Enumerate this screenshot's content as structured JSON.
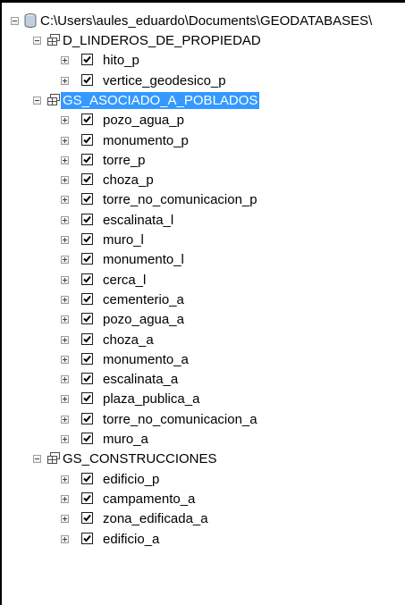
{
  "root": {
    "label": "C:\\Users\\aules_eduardo\\Documents\\GEODATABASES\\",
    "icon": "database-icon"
  },
  "datasets": [
    {
      "label": "D_LINDEROS_DE_PROPIEDAD",
      "icon": "feature-dataset-icon",
      "selected": false,
      "layers": [
        "hito_p",
        "vertice_geodesico_p"
      ]
    },
    {
      "label": "GS_ASOCIADO_A_POBLADOS",
      "icon": "feature-dataset-icon",
      "selected": true,
      "layers": [
        "pozo_agua_p",
        "monumento_p",
        "torre_p",
        "choza_p",
        "torre_no_comunicacion_p",
        "escalinata_l",
        "muro_l",
        "monumento_l",
        "cerca_l",
        "cementerio_a",
        "pozo_agua_a",
        "choza_a",
        "monumento_a",
        "escalinata_a",
        "plaza_publica_a",
        "torre_no_comunicacion_a",
        "muro_a"
      ]
    },
    {
      "label": "GS_CONSTRUCCIONES",
      "icon": "feature-dataset-icon",
      "selected": false,
      "layers": [
        "edificio_p",
        "campamento_a",
        "zona_edificada_a",
        "edificio_a"
      ]
    }
  ],
  "colors": {
    "selection": "#3399ff",
    "check": "#000000"
  }
}
